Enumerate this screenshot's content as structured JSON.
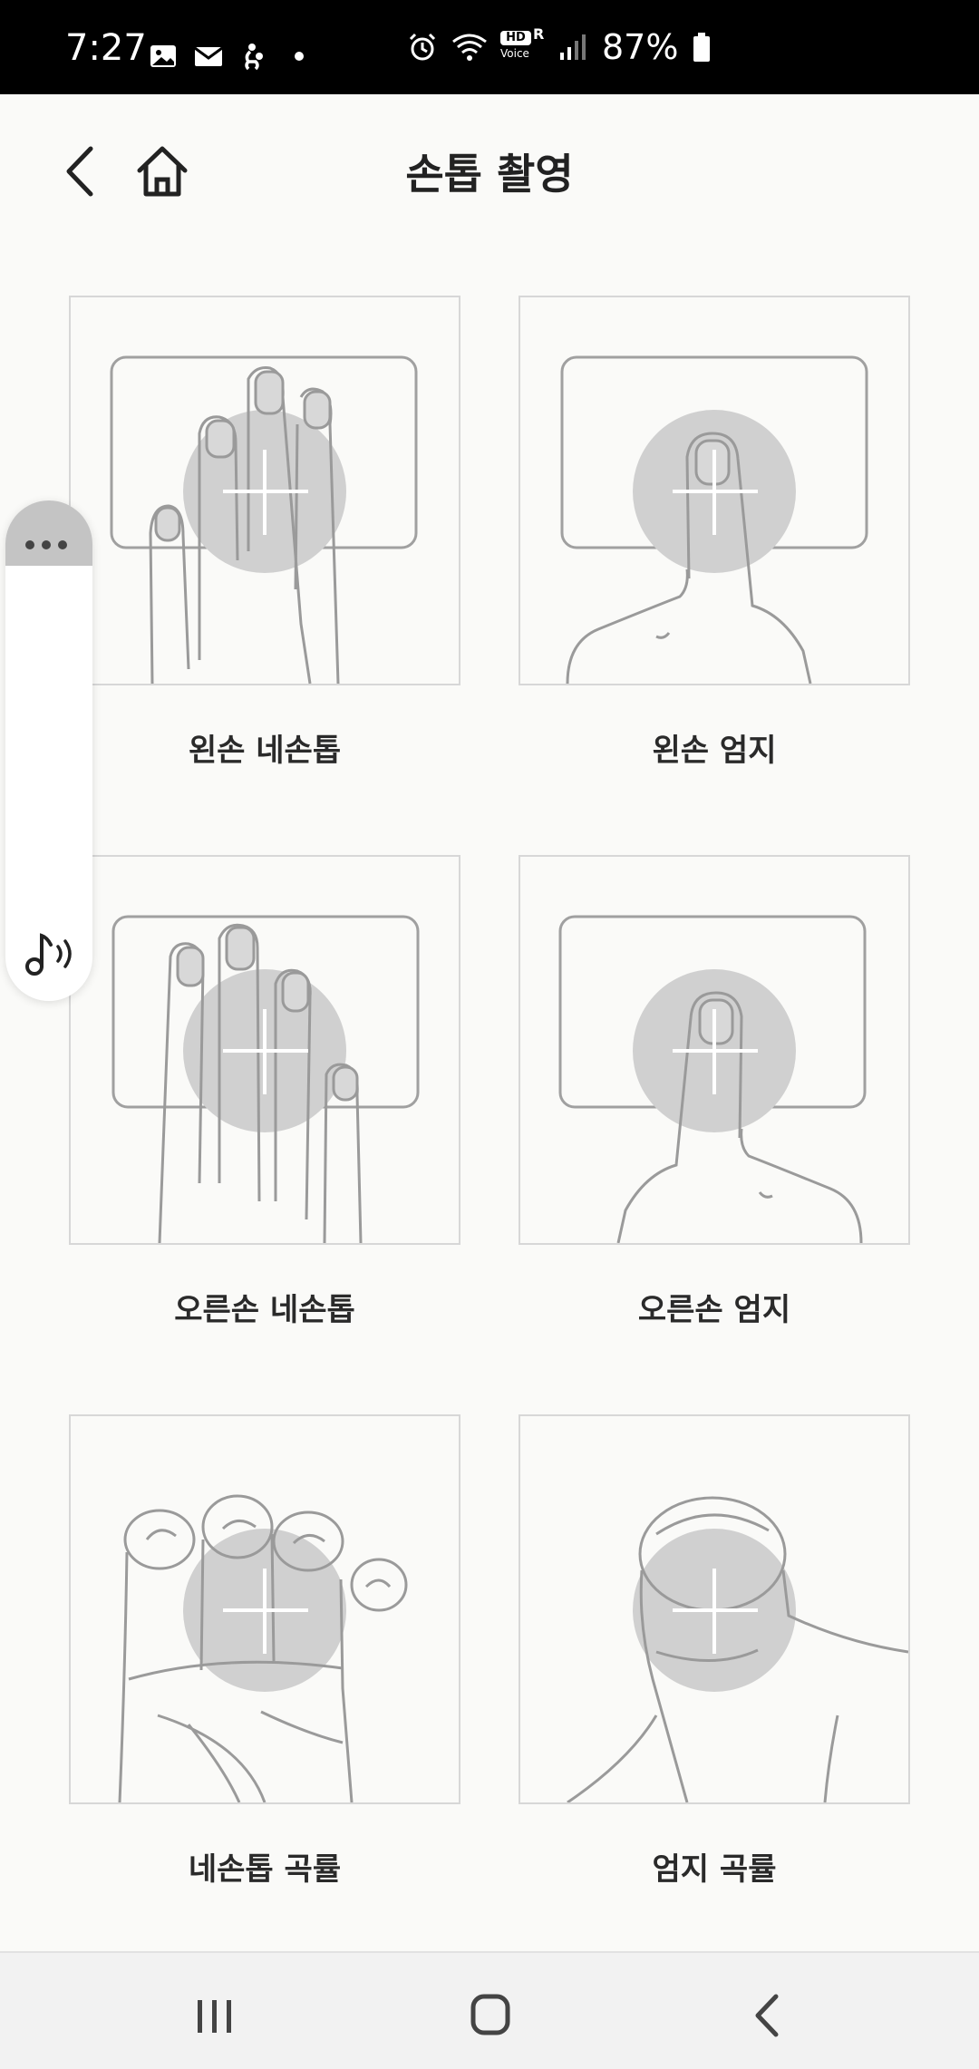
{
  "status_bar": {
    "time": "7:27",
    "left_icons": [
      "gallery-icon",
      "mail-icon",
      "accessibility-icon",
      "dot-icon"
    ],
    "right_icons": [
      "alarm-icon",
      "wifi-icon",
      "hd-voice-icon",
      "signal-icon"
    ],
    "hd_label": "HD",
    "voice_label": "Voice",
    "roaming_label": "R",
    "battery_text": "87%",
    "battery_icon": "battery-icon"
  },
  "header": {
    "title": "손톱 촬영",
    "back_icon": "chevron-left-icon",
    "home_icon": "home-icon"
  },
  "cards": [
    {
      "label": "왼손 네손톱",
      "image": "left-four-nails-illustration"
    },
    {
      "label": "왼손 엄지",
      "image": "left-thumb-illustration"
    },
    {
      "label": "오른손 네손톱",
      "image": "right-four-nails-illustration"
    },
    {
      "label": "오른손 엄지",
      "image": "right-thumb-illustration"
    },
    {
      "label": "네손톱 곡률",
      "image": "four-nails-curvature-illustration"
    },
    {
      "label": "엄지 곡률",
      "image": "thumb-curvature-illustration"
    }
  ],
  "floating_panel": {
    "menu_icon": "more-horizontal-icon",
    "audio_icon": "music-sound-icon"
  },
  "nav_bar": {
    "recent_icon": "recent-apps-icon",
    "home_icon": "home-square-icon",
    "back_icon": "back-chevron-icon"
  },
  "colors": {
    "background": "#fafaf8",
    "card_border": "#d7d7d7",
    "target_circle": "#d0d0d0",
    "line_art": "#9a9a9a"
  }
}
